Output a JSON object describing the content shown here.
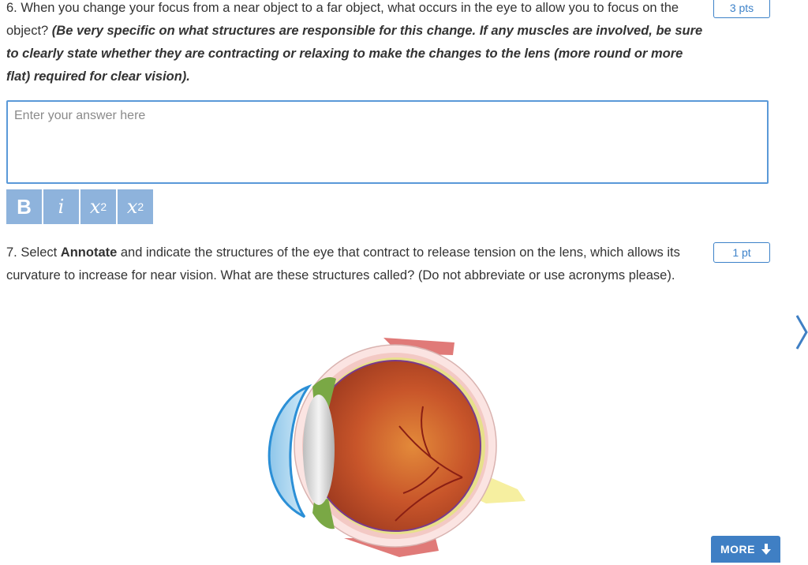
{
  "question6": {
    "number_text": "6. When you change your focus from a near object to a far object, what occurs in the eye to allow you to focus on the object? ",
    "emphasis_text": "(Be very specific on what structures are responsible for this change. If any muscles are involved, be sure to clearly state whether they are contracting or relaxing to make the changes to the lens (more round or more flat) required for clear vision).",
    "points": "3 pts",
    "answer_placeholder": "Enter your answer here",
    "answer_value": ""
  },
  "toolbar": {
    "bold_label": "B",
    "italic_label": "i",
    "subscript_base": "x",
    "subscript_label": "2",
    "superscript_base": "x",
    "superscript_label": "2"
  },
  "question7": {
    "text_before": "7. Select ",
    "bold_word": "Annotate",
    "text_after": " and indicate the structures of the eye that contract to release tension on the lens, which allows its curvature to increase for near vision. What are these structures called? (Do not abbreviate or use acronyms please).",
    "points": "1 pt"
  },
  "more_button": {
    "label": "MORE",
    "icon": "arrow-down-icon"
  },
  "navigation": {
    "next_icon": "chevron-right-icon"
  },
  "colors": {
    "accent": "#3f7fc4",
    "toolbar_button": "#8eb3dc",
    "input_border": "#5a99d8"
  }
}
